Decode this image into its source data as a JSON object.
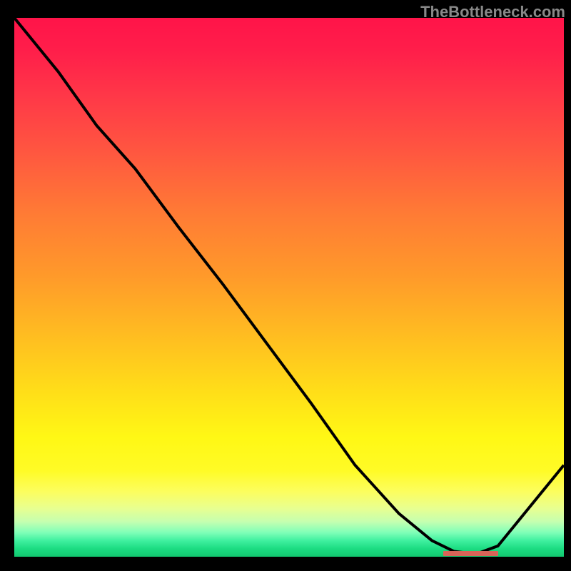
{
  "watermark": "TheBottleneck.com",
  "chart_data": {
    "type": "line",
    "title": "",
    "xlabel": "",
    "ylabel": "",
    "xlim": [
      0,
      100
    ],
    "ylim": [
      0,
      100
    ],
    "series": [
      {
        "name": "curve",
        "x": [
          0,
          8,
          15,
          22,
          30,
          38,
          46,
          54,
          62,
          70,
          76,
          80,
          84,
          88,
          100
        ],
        "y": [
          100,
          90,
          80,
          72,
          61,
          50.5,
          39.5,
          28.5,
          17,
          8,
          3,
          1,
          0.5,
          2,
          17
        ]
      }
    ],
    "marker": {
      "x_start": 78,
      "x_end": 88,
      "y": 0.7
    },
    "colors": {
      "curve": "#000000",
      "marker": "#d86458",
      "gradient_top": "#ff1449",
      "gradient_mid": "#ffe018",
      "gradient_bottom": "#12c870"
    }
  }
}
